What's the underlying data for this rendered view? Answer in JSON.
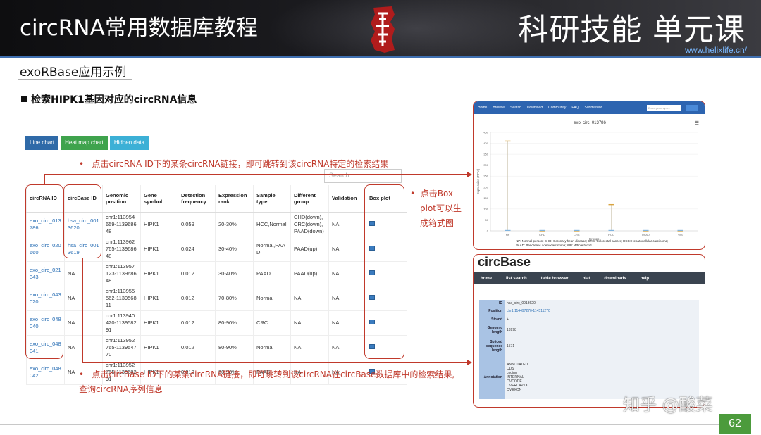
{
  "banner": {
    "title": "circRNA常用数据库教程",
    "right_title": "科研技能 单元课",
    "url": "www.helixlife.cn/"
  },
  "subtitle": "exoRBase应用示例",
  "bullet_heading": "检索HIPK1基因对应的circRNA信息",
  "chart_buttons": [
    {
      "label": "Line chart",
      "color": "#2f6aa8"
    },
    {
      "label": "Heat map chart",
      "color": "#3fa34d"
    },
    {
      "label": "Hidden data",
      "color": "#3cb0d6"
    }
  ],
  "search_placeholder": "Search",
  "table": {
    "headers": [
      "circRNA ID",
      "circBase ID",
      "Genomic position",
      "Gene symbol",
      "Detection frequency",
      "Expression rank",
      "Sample type",
      "Different group",
      "Validation",
      "Box plot"
    ],
    "rows": [
      [
        "exo_circ_013786",
        "hsa_circ_0013620",
        "chr1:113954659-113968648",
        "HIPK1",
        "0.059",
        "20-30%",
        "HCC,Normal",
        "CHD(down),CRC(down),PAAD(down)",
        "NA",
        ""
      ],
      [
        "exo_circ_020660",
        "hsa_circ_0013619",
        "chr1:113962765-113968648",
        "HIPK1",
        "0.024",
        "30-40%",
        "Normal,PAAD",
        "PAAD(up)",
        "NA",
        ""
      ],
      [
        "exo_circ_021343",
        "NA",
        "chr1:113957123-113968648",
        "HIPK1",
        "0.012",
        "30-40%",
        "PAAD",
        "PAAD(up)",
        "NA",
        ""
      ],
      [
        "exo_circ_043020",
        "NA",
        "chr1:113955562-113956811",
        "HIPK1",
        "0.012",
        "70-80%",
        "Normal",
        "NA",
        "NA",
        ""
      ],
      [
        "exo_circ_048040",
        "NA",
        "chr1:113940420-113958291",
        "HIPK1",
        "0.012",
        "80-90%",
        "CRC",
        "NA",
        "NA",
        ""
      ],
      [
        "exo_circ_048041",
        "NA",
        "chr1:113952765-113954770",
        "HIPK1",
        "0.012",
        "80-90%",
        "Normal",
        "NA",
        "NA",
        ""
      ],
      [
        "exo_circ_048042",
        "NA",
        "chr1:113952765-113968291",
        "HIPK1",
        "0.012",
        "80-90%",
        "PAAD",
        "NA",
        "NA",
        ""
      ]
    ]
  },
  "notes": {
    "circrna_id": "点击circRNA ID下的某条circRNA链接，即可跳转到该circRNA特定的检索结果",
    "boxplot_1": "点击Box",
    "boxplot_2": "plot可以生",
    "boxplot_3": "成箱式图",
    "circbase_1": "点击circBase ID下的某条circRNA链接，即可跳转到该circRNA在circBase数据库中的检索结果,",
    "circbase_2": "查询circRNA序列信息",
    "bullet": "•"
  },
  "exorbase_shot": {
    "nav": [
      "Home",
      "Browse",
      "Search",
      "Download",
      "Community",
      "FAQ",
      "Submission"
    ],
    "nav_search_placeholder": "Enter gene sym...",
    "chart_title": "exo_circ_013786",
    "y_label": "Expression (RPM)",
    "x_label": "Groups",
    "legend_line1": "NP: Normal person; CHD: Coronary heart disease; CRC: Colorectal cancer; HCC: Hepatocellular carcinoma;",
    "legend_line2": "PAAD: Pancreatic adenocarcinoma; WB: Whole blood"
  },
  "chart_data": {
    "type": "bar",
    "title": "exo_circ_013786",
    "xlabel": "Groups",
    "ylabel": "Expression (RPM)",
    "categories": [
      "NP",
      "CHD",
      "CRC",
      "HCC",
      "PAAD",
      "WB"
    ],
    "values": [
      410,
      0,
      0,
      120,
      0,
      0
    ],
    "yticks": [
      0,
      50,
      100,
      150,
      200,
      250,
      300,
      350,
      400,
      450
    ],
    "ylim": [
      0,
      450
    ]
  },
  "circbase_shot": {
    "title": "circBase",
    "nav": [
      "home",
      "list search",
      "table browser",
      "blat",
      "downloads",
      "help"
    ],
    "fields": [
      {
        "key": "ID",
        "value": "hsa_circ_0013620"
      },
      {
        "key": "Position",
        "value": "chr1:114497270-114511270"
      },
      {
        "key": "Strand",
        "value": "+"
      },
      {
        "key": "Genomic length",
        "value": "13998"
      },
      {
        "key": "Spliced sequence length",
        "value": "1571"
      },
      {
        "key": "Annotation",
        "value": "ANNOTATED\nCDS\ncoding\nINTERNAL\nOVCODE\nOVERLAPTX\nOVEXON"
      }
    ]
  },
  "watermark": "知乎 @酸菜",
  "page_number": "62",
  "colors": {
    "accent_red": "#c0392b",
    "link_blue": "#2a6fb5",
    "page_green": "#4c9b3c"
  }
}
